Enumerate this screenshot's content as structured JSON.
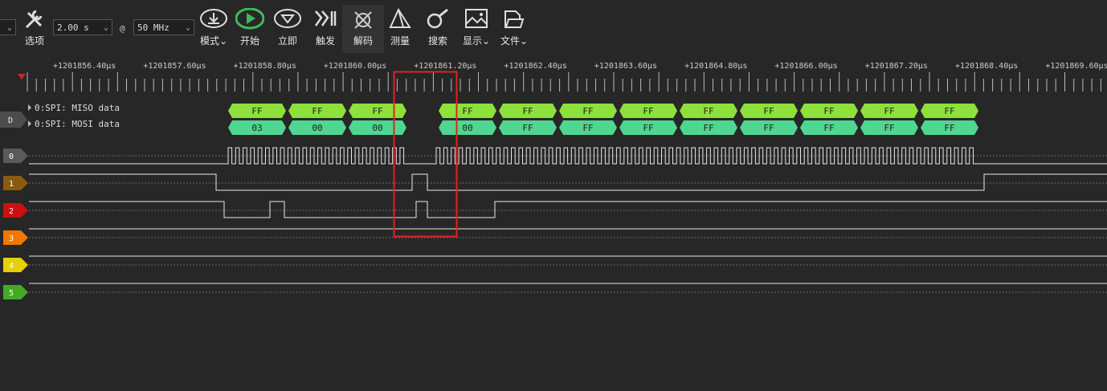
{
  "toolbar": {
    "duration": "2.00 s",
    "at": "@",
    "rate": "50 MHz",
    "options_label": "选项",
    "mode_label": "模式",
    "start_label": "开始",
    "immediate_label": "立即",
    "trigger_label": "触发",
    "decode_label": "解码",
    "measure_label": "测量",
    "search_label": "搜索",
    "display_label": "显示",
    "file_label": "文件"
  },
  "ruler": {
    "ticks": [
      "+1201856.40μs",
      "+1201857.60μs",
      "+1201858.80μs",
      "+1201860.00μs",
      "+1201861.20μs",
      "+1201862.40μs",
      "+1201863.60μs",
      "+1201864.80μs",
      "+1201866.00μs",
      "+1201867.20μs",
      "+1201868.40μs",
      "+1201869.60μs"
    ]
  },
  "decoder": {
    "tag": "D",
    "miso_label": "0:SPI: MISO data",
    "mosi_label": "0:SPI: MOSI data",
    "miso_values": [
      "FF",
      "FF",
      "FF",
      "FF",
      "FF",
      "FF",
      "FF",
      "FF",
      "FF",
      "FF",
      "FF",
      "FF"
    ],
    "mosi_values": [
      "03",
      "00",
      "00",
      "00",
      "FF",
      "FF",
      "FF",
      "FF",
      "FF",
      "FF",
      "FF",
      "FF"
    ]
  },
  "channels": [
    {
      "id": "0",
      "color": "#5a5a5a"
    },
    {
      "id": "1",
      "color": "#8a5a10"
    },
    {
      "id": "2",
      "color": "#cc1010"
    },
    {
      "id": "3",
      "color": "#f07800"
    },
    {
      "id": "4",
      "color": "#e6d000"
    },
    {
      "id": "5",
      "color": "#44aa22"
    }
  ],
  "colors": {
    "miso": "#8ee03a",
    "mosi": "#4fd690",
    "highlight": "#e0231f",
    "trace": "#e8e8e8"
  }
}
